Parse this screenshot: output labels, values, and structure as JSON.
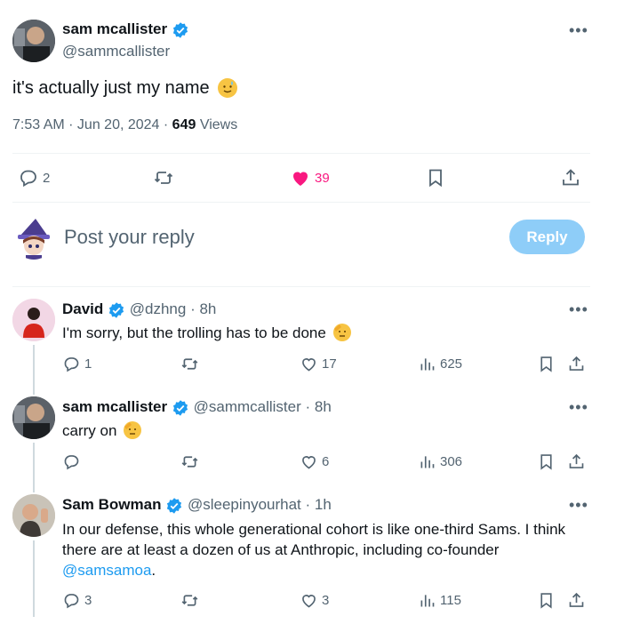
{
  "main_post": {
    "display_name": "sam mcallister",
    "handle": "@sammcallister",
    "text": "it's actually just my name",
    "emoji": "😅",
    "time": "7:53 AM · Jun 20, 2024 · ",
    "views_count": "649",
    "views_label": " Views",
    "replies": "2",
    "likes": "39",
    "liked": true
  },
  "composer": {
    "placeholder": "Post your reply",
    "reply_button": "Reply"
  },
  "replies": [
    {
      "display_name": "David",
      "handle": "@dzhng",
      "time": "8h",
      "text": "I'm sorry, but the trolling has to be done",
      "replies": "1",
      "likes": "17",
      "views": "625"
    },
    {
      "display_name": "sam mcallister",
      "handle": "@sammcallister",
      "time": "8h",
      "text": "carry on",
      "replies": "",
      "likes": "6",
      "views": "306"
    },
    {
      "display_name": "Sam Bowman",
      "handle": "@sleepinyourhat",
      "time": "1h",
      "text": "In our defense, this whole generational cohort is like one-third Sams. I think there are at least a dozen of us at Anthropic, including co-founder",
      "mention": "@samsamoa",
      "text_end": ".",
      "replies": "3",
      "likes": "3",
      "views": "115"
    }
  ],
  "colors": {
    "accent": "#1d9bf0",
    "like": "#f91880",
    "muted": "#536471",
    "reply_button_disabled": "#8ecdf8"
  },
  "icons": [
    "verified-badge-icon",
    "more-icon",
    "reply-icon",
    "repost-icon",
    "like-icon",
    "bookmark-icon",
    "share-icon",
    "views-icon"
  ]
}
